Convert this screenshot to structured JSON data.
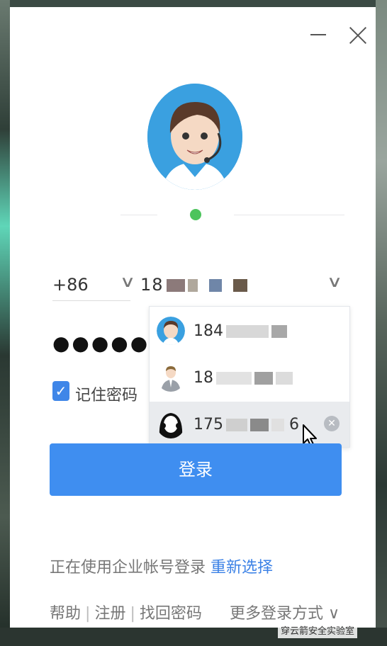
{
  "phone": {
    "country_code": "+86",
    "visible_prefix": "18"
  },
  "password": {
    "masked_value": "●●●●●●●●●"
  },
  "remember": {
    "label": "记住密码"
  },
  "dropdown": {
    "accounts": [
      {
        "number": "184",
        "avatar": "male-headset-avatar"
      },
      {
        "number": "18",
        "avatar": "businessman-avatar"
      },
      {
        "number": "175",
        "suffix": "6",
        "avatar": "female-headset-avatar"
      }
    ]
  },
  "login_button": "登录",
  "enterprise": {
    "text": "正在使用企业帐号登录",
    "link": "重新选择"
  },
  "footer": {
    "help": "帮助",
    "sep": "|",
    "register": "注册",
    "recover": "找回密码",
    "more": "更多登录方式 ∨"
  },
  "watermark": "穿云箭安全实验室",
  "colors": {
    "accent": "#3f8ef0",
    "link": "#3c82e6",
    "status": "#4cc45c"
  }
}
